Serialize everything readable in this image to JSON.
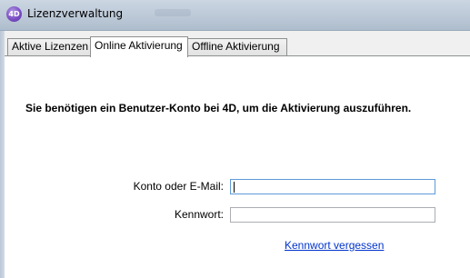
{
  "window": {
    "title": "Lizenzverwaltung",
    "icon": "4D"
  },
  "tabs": [
    {
      "label": "Aktive Lizenzen",
      "active": false
    },
    {
      "label": "Online Aktivierung",
      "active": true
    },
    {
      "label": "Offline Aktivierung",
      "active": false
    }
  ],
  "main": {
    "notice": "Sie benötigen ein Benutzer-Konto bei 4D, um die Aktivierung auszuführen.",
    "account_label": "Konto oder E-Mail:",
    "account_value": "",
    "password_label": "Kennwort:",
    "password_value": "",
    "forgot_link": "Kennwort vergessen"
  }
}
